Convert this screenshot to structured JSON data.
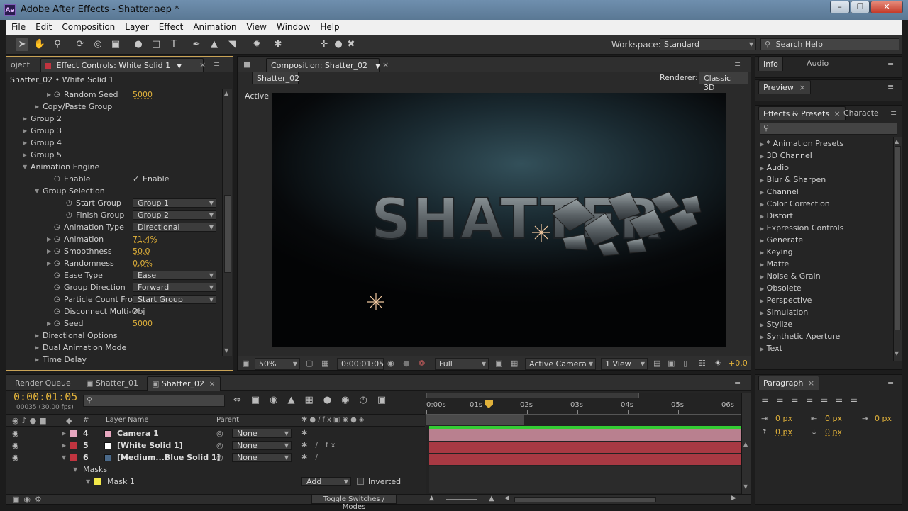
{
  "titlebar": {
    "title": "Adobe After Effects - Shatter.aep *",
    "icon": "Ae"
  },
  "menu": [
    "File",
    "Edit",
    "Composition",
    "Layer",
    "Effect",
    "Animation",
    "View",
    "Window",
    "Help"
  ],
  "toolbar": {
    "workspace_label": "Workspace:",
    "workspace_value": "Standard",
    "search_placeholder": "Search Help"
  },
  "effect_controls": {
    "tab_project": "oject",
    "tab_label": "Effect Controls: White Solid 1",
    "layer_path": "Shatter_02 • White Solid 1",
    "rows": [
      {
        "label": "Random Seed",
        "value": "5000",
        "kind": "num"
      },
      {
        "label": "Copy/Paste Group",
        "kind": "group"
      },
      {
        "label": "Group 2",
        "kind": "group"
      },
      {
        "label": "Group 3",
        "kind": "group"
      },
      {
        "label": "Group 4",
        "kind": "group"
      },
      {
        "label": "Group 5",
        "kind": "group"
      },
      {
        "label": "Animation Engine",
        "kind": "group-open"
      },
      {
        "label": "Enable",
        "value": "Enable",
        "kind": "check"
      },
      {
        "label": "Group Selection",
        "kind": "group-open"
      },
      {
        "label": "Start Group",
        "value": "Group 1",
        "kind": "select"
      },
      {
        "label": "Finish Group",
        "value": "Group 2",
        "kind": "select"
      },
      {
        "label": "Animation Type",
        "value": "Directional",
        "kind": "select"
      },
      {
        "label": "Animation",
        "value": "71.4%",
        "kind": "num"
      },
      {
        "label": "Smoothness",
        "value": "50.0",
        "kind": "num"
      },
      {
        "label": "Randomness",
        "value": "0.0%",
        "kind": "num"
      },
      {
        "label": "Ease Type",
        "value": "Ease",
        "kind": "select"
      },
      {
        "label": "Group Direction",
        "value": "Forward",
        "kind": "select"
      },
      {
        "label": "Particle Count From",
        "value": "Start Group",
        "kind": "select"
      },
      {
        "label": "Disconnect Multi-Obj",
        "value": "✓",
        "kind": "check"
      },
      {
        "label": "Seed",
        "value": "5000",
        "kind": "num"
      },
      {
        "label": "Directional Options",
        "kind": "group"
      },
      {
        "label": "Dual Animation Mode",
        "kind": "group"
      },
      {
        "label": "Time Delay",
        "kind": "group"
      }
    ]
  },
  "composition": {
    "tab_label": "Composition: Shatter_02",
    "comp_button": "Shatter_02",
    "renderer_label": "Renderer:",
    "renderer_value": "Classic 3D",
    "view_label": "Active Camera",
    "viewer_text": "SHATTER",
    "footer": {
      "zoom": "50%",
      "timecode": "0:00:01:05",
      "resolution": "Full",
      "camera": "Active Camera",
      "views": "1 View",
      "exposure": "+0.0"
    }
  },
  "right": {
    "info_tab": "Info",
    "audio_tab": "Audio",
    "preview_tab": "Preview",
    "effects_tab": "Effects & Presets",
    "character_tab": "Characte",
    "fx_search_placeholder": "ρˉ",
    "fx_list": [
      "* Animation Presets",
      "3D Channel",
      "Audio",
      "Blur & Sharpen",
      "Channel",
      "Color Correction",
      "Distort",
      "Expression Controls",
      "Generate",
      "Keying",
      "Matte",
      "Noise & Grain",
      "Obsolete",
      "Perspective",
      "Simulation",
      "Stylize",
      "Synthetic Aperture",
      "Text"
    ],
    "paragraph_tab": "Paragraph",
    "paragraph_values": [
      "0 px",
      "0 px",
      "0 px",
      "0 px",
      "0 px"
    ]
  },
  "timeline": {
    "tabs": [
      "Render Queue",
      "Shatter_01",
      "Shatter_02"
    ],
    "timecode": "0:00:01:05",
    "frames": "00035 (30.00 fps)",
    "col_num": "#",
    "col_layer": "Layer Name",
    "col_parent": "Parent",
    "ruler": [
      "0:00s",
      "01s",
      "02s",
      "03s",
      "04s",
      "05s",
      "06s"
    ],
    "layers": [
      {
        "num": "4",
        "name": "Camera 1",
        "parent": "None",
        "color": "#e7a8c0"
      },
      {
        "num": "5",
        "name": "[White Solid 1]",
        "parent": "None",
        "color": "#c0343f"
      },
      {
        "num": "6",
        "name": "[Medium...Blue Solid 1]",
        "parent": "None",
        "color": "#c0343f"
      }
    ],
    "masks_label": "Masks",
    "mask_name": "Mask 1",
    "mask_mode": "Add",
    "inverted_label": "Inverted",
    "toggle_label": "Toggle Switches / Modes"
  },
  "colors": {
    "accent": "#e1b23b",
    "playhead": "#e03030",
    "layer_bar": "#7d2a34",
    "camera_bar": "#b9808f"
  }
}
